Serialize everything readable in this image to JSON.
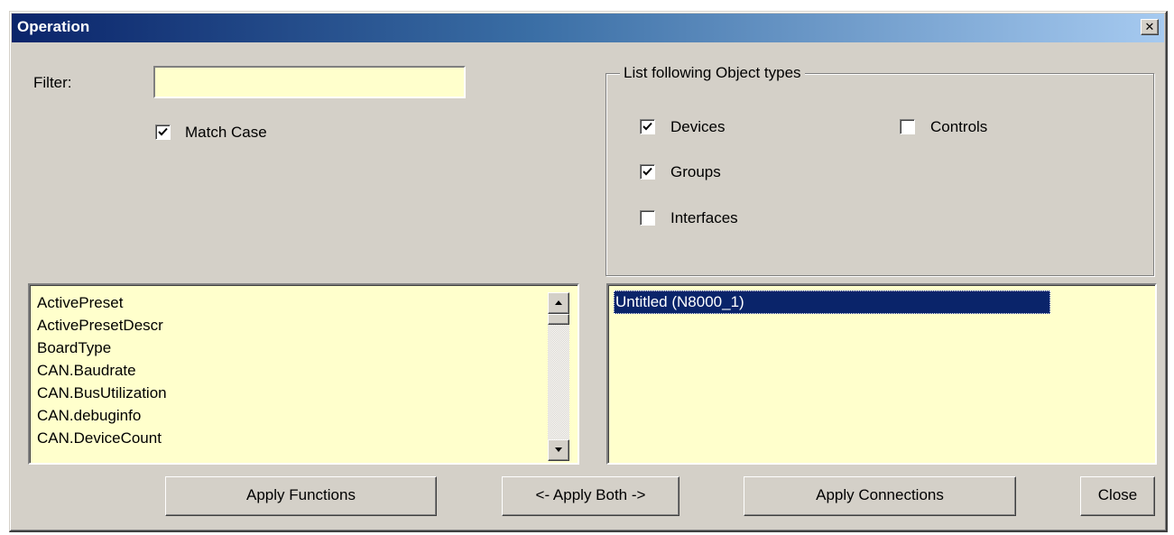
{
  "window": {
    "title": "Operation",
    "close_glyph": "✕"
  },
  "filter": {
    "label": "Filter:",
    "value": "",
    "placeholder": "",
    "match_case_label": "Match Case",
    "match_case_checked": true
  },
  "object_types": {
    "legend": "List following Object types",
    "devices": {
      "label": "Devices",
      "checked": true
    },
    "controls": {
      "label": "Controls",
      "checked": false
    },
    "groups": {
      "label": "Groups",
      "checked": true
    },
    "interfaces": {
      "label": "Interfaces",
      "checked": false
    }
  },
  "functions_list": {
    "items": [
      "ActivePreset",
      "ActivePresetDescr",
      "BoardType",
      "CAN.Baudrate",
      "CAN.BusUtilization",
      "CAN.debuginfo",
      "CAN.DeviceCount"
    ]
  },
  "objects_list": {
    "selected_item": "Untitled (N8000_1)"
  },
  "buttons": {
    "apply_functions": "Apply Functions",
    "apply_both": "<- Apply Both ->",
    "apply_connections": "Apply Connections",
    "close": "Close"
  },
  "colors": {
    "titlebar_start": "#0a246a",
    "titlebar_end": "#a6caf0",
    "dialog_face": "#d4d0c8",
    "list_background": "#ffffcc",
    "selection": "#0a246a"
  }
}
